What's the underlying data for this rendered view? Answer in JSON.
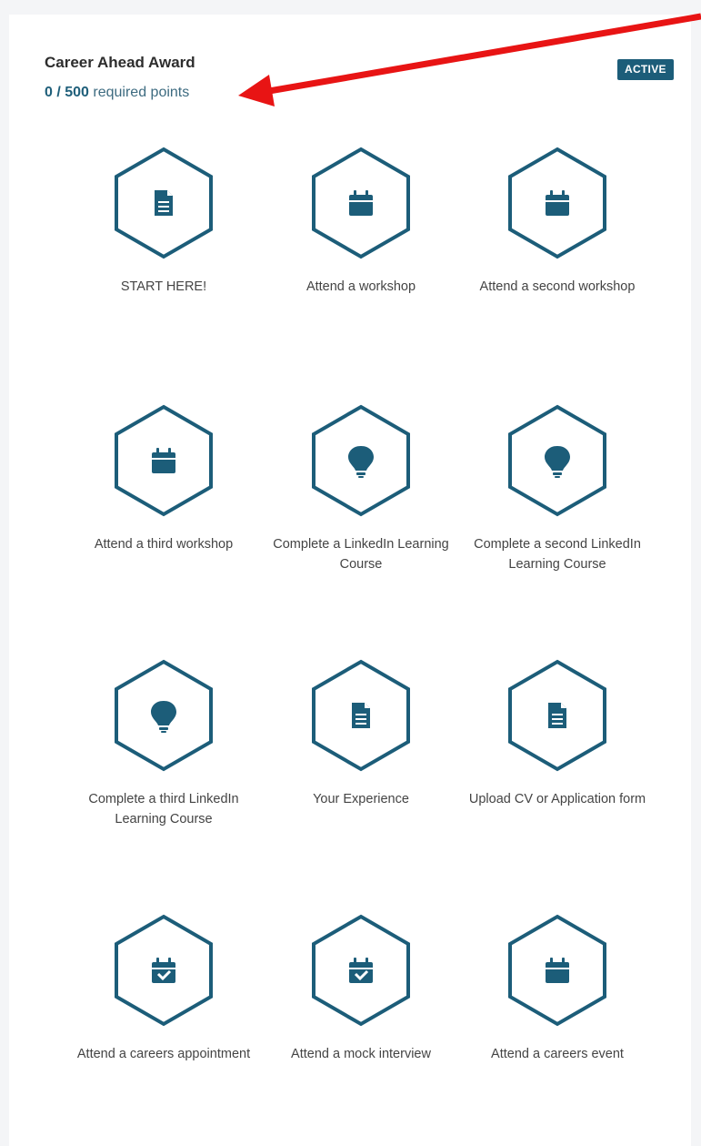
{
  "award": {
    "title": "Career Ahead Award",
    "points_current_total": "0 / 500",
    "points_suffix": "required points",
    "status": "ACTIVE"
  },
  "colors": {
    "accent": "#1c5d79",
    "arrow": "#e81414"
  },
  "items": [
    {
      "label": "START HERE!",
      "icon": "document-icon"
    },
    {
      "label": "Attend a workshop",
      "icon": "calendar-icon"
    },
    {
      "label": "Attend a second workshop",
      "icon": "calendar-icon"
    },
    {
      "label": "Attend a third workshop",
      "icon": "calendar-icon"
    },
    {
      "label": "Complete a LinkedIn Learning Course",
      "icon": "lightbulb-icon"
    },
    {
      "label": "Complete a second LinkedIn Learning Course",
      "icon": "lightbulb-icon"
    },
    {
      "label": "Complete a third LinkedIn Learning Course",
      "icon": "lightbulb-icon"
    },
    {
      "label": "Your Experience",
      "icon": "document-icon"
    },
    {
      "label": "Upload CV or Application form",
      "icon": "document-icon"
    },
    {
      "label": "Attend a careers appointment",
      "icon": "calendar-check-icon"
    },
    {
      "label": "Attend a mock interview",
      "icon": "calendar-check-icon"
    },
    {
      "label": "Attend a careers event",
      "icon": "calendar-icon"
    }
  ]
}
